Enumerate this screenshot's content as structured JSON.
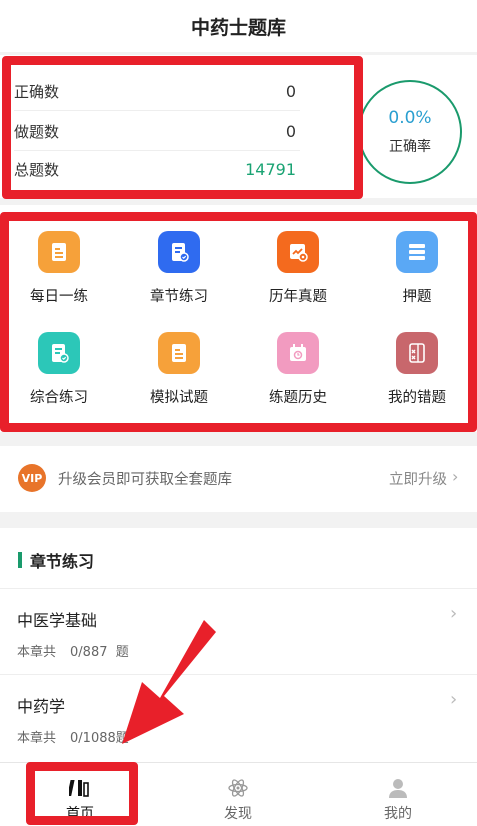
{
  "header": {
    "title": "中药士题库"
  },
  "stats": {
    "rows": [
      {
        "label": "正确数",
        "value": "0"
      },
      {
        "label": "做题数",
        "value": "0"
      },
      {
        "label": "总题数",
        "value": "14791"
      }
    ],
    "rate_value": "0.0%",
    "rate_label": "正确率"
  },
  "grid": [
    {
      "label": "每日一练",
      "icon": "daily-practice-icon",
      "color": "#f6a13a"
    },
    {
      "label": "章节练习",
      "icon": "chapter-practice-icon",
      "color": "#2f6bf0"
    },
    {
      "label": "历年真题",
      "icon": "past-exams-icon",
      "color": "#f46a1e"
    },
    {
      "label": "押题",
      "icon": "predicted-questions-icon",
      "color": "#5aa8f5"
    },
    {
      "label": "综合练习",
      "icon": "comprehensive-practice-icon",
      "color": "#2cc7b8"
    },
    {
      "label": "模拟试题",
      "icon": "mock-exam-icon",
      "color": "#f6a13a"
    },
    {
      "label": "练题历史",
      "icon": "practice-history-icon",
      "color": "#f29bc0"
    },
    {
      "label": "我的错题",
      "icon": "wrong-questions-icon",
      "color": "#c8676c"
    }
  ],
  "upgrade": {
    "badge": "VIP",
    "text": "升级会员即可获取全套题库",
    "action": "立即升级",
    "chevron": "›"
  },
  "chapters": {
    "title": "章节练习",
    "items": [
      {
        "name": "中医学基础",
        "prefix": "本章共",
        "count": "0/887  题"
      },
      {
        "name": "中药学",
        "prefix": "本章共",
        "count": "0/1088题"
      }
    ]
  },
  "tabs": [
    {
      "label": "首页",
      "icon": "books-icon"
    },
    {
      "label": "发现",
      "icon": "atom-icon"
    },
    {
      "label": "我的",
      "icon": "person-icon"
    }
  ],
  "colors": {
    "accent": "#1a9a6c",
    "annotation": "#e8202a"
  }
}
